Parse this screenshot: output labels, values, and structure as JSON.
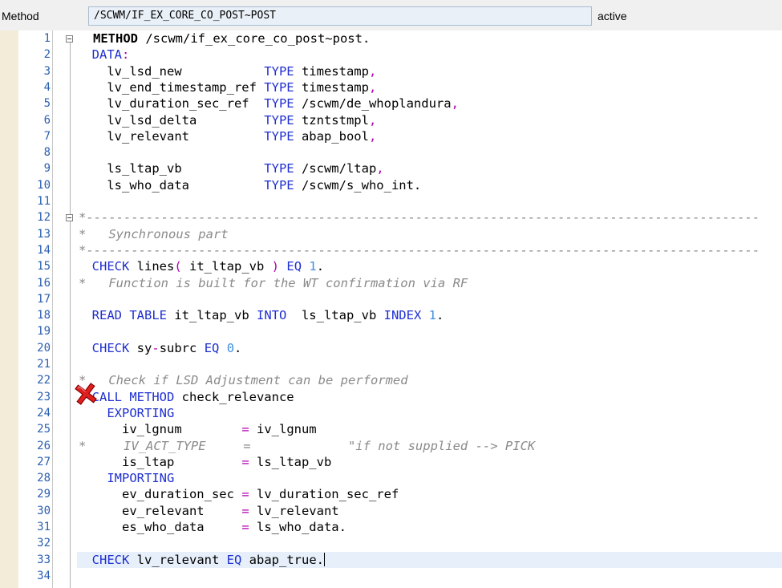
{
  "header": {
    "label": "Method",
    "method_name": "/SCWM/IF_EX_CORE_CO_POST~POST",
    "status": "active"
  },
  "editor": {
    "current_line": 33,
    "lines": [
      {
        "n": "1",
        "parts": [
          [
            "kwb",
            "METHOD"
          ],
          [
            "",
            " /scwm/if_ex_core_co_post~post."
          ]
        ]
      },
      {
        "n": "2",
        "parts": [
          [
            "",
            "  "
          ],
          [
            "kw",
            "DATA"
          ],
          [
            "op",
            ":"
          ]
        ]
      },
      {
        "n": "3",
        "parts": [
          [
            "",
            "    lv_lsd_new           "
          ],
          [
            "kw",
            "TYPE"
          ],
          [
            "",
            " timestamp"
          ],
          [
            "op",
            ","
          ]
        ]
      },
      {
        "n": "4",
        "parts": [
          [
            "",
            "    lv_end_timestamp_ref "
          ],
          [
            "kw",
            "TYPE"
          ],
          [
            "",
            " timestamp"
          ],
          [
            "op",
            ","
          ]
        ]
      },
      {
        "n": "5",
        "parts": [
          [
            "",
            "    lv_duration_sec_ref  "
          ],
          [
            "kw",
            "TYPE"
          ],
          [
            "",
            " /scwm/de_whoplandura"
          ],
          [
            "op",
            ","
          ]
        ]
      },
      {
        "n": "6",
        "parts": [
          [
            "",
            "    lv_lsd_delta         "
          ],
          [
            "kw",
            "TYPE"
          ],
          [
            "",
            " tzntstmpl"
          ],
          [
            "op",
            ","
          ]
        ]
      },
      {
        "n": "7",
        "parts": [
          [
            "",
            "    lv_relevant          "
          ],
          [
            "kw",
            "TYPE"
          ],
          [
            "",
            " abap_bool"
          ],
          [
            "op",
            ","
          ]
        ]
      },
      {
        "n": "8",
        "parts": []
      },
      {
        "n": "9",
        "parts": [
          [
            "",
            "    ls_ltap_vb           "
          ],
          [
            "kw",
            "TYPE"
          ],
          [
            "",
            " /scwm/ltap"
          ],
          [
            "op",
            ","
          ]
        ]
      },
      {
        "n": "10",
        "parts": [
          [
            "",
            "    ls_who_data          "
          ],
          [
            "kw",
            "TYPE"
          ],
          [
            "",
            " /scwm/s_who_int."
          ]
        ]
      },
      {
        "n": "11",
        "parts": []
      },
      {
        "n": "12",
        "parts": [
          [
            "cmt",
            "*------------------------------------------------------------------------------------------"
          ]
        ]
      },
      {
        "n": "13",
        "parts": [
          [
            "cmt",
            "*   Synchronous part"
          ]
        ]
      },
      {
        "n": "14",
        "parts": [
          [
            "cmt",
            "*------------------------------------------------------------------------------------------"
          ]
        ]
      },
      {
        "n": "15",
        "parts": [
          [
            "",
            "  "
          ],
          [
            "kw",
            "CHECK"
          ],
          [
            "",
            " lines"
          ],
          [
            "op",
            "("
          ],
          [
            "",
            " it_ltap_vb "
          ],
          [
            "op",
            ")"
          ],
          [
            "",
            " "
          ],
          [
            "kw",
            "EQ"
          ],
          [
            "",
            " "
          ],
          [
            "num",
            "1"
          ],
          [
            "",
            "."
          ]
        ]
      },
      {
        "n": "16",
        "parts": [
          [
            "cmt",
            "*   Function is built for the WT confirmation via RF"
          ]
        ]
      },
      {
        "n": "17",
        "parts": []
      },
      {
        "n": "18",
        "parts": [
          [
            "",
            "  "
          ],
          [
            "kw",
            "READ TABLE"
          ],
          [
            "",
            " it_ltap_vb "
          ],
          [
            "kw",
            "INTO"
          ],
          [
            "",
            "  ls_ltap_vb "
          ],
          [
            "kw",
            "INDEX"
          ],
          [
            "",
            " "
          ],
          [
            "num",
            "1"
          ],
          [
            "",
            "."
          ]
        ]
      },
      {
        "n": "19",
        "parts": []
      },
      {
        "n": "20",
        "parts": [
          [
            "",
            "  "
          ],
          [
            "kw",
            "CHECK"
          ],
          [
            "",
            " sy"
          ],
          [
            "op",
            "-"
          ],
          [
            "",
            "subrc "
          ],
          [
            "kw",
            "EQ"
          ],
          [
            "",
            " "
          ],
          [
            "num",
            "0"
          ],
          [
            "",
            "."
          ]
        ]
      },
      {
        "n": "21",
        "parts": []
      },
      {
        "n": "22",
        "parts": [
          [
            "cmt",
            "*   Check if LSD Adjustment can be performed"
          ]
        ]
      },
      {
        "n": "23",
        "parts": [
          [
            "",
            "  "
          ],
          [
            "kw",
            "CALL METHOD"
          ],
          [
            "",
            " check_relevance"
          ]
        ]
      },
      {
        "n": "24",
        "parts": [
          [
            "",
            "    "
          ],
          [
            "kw",
            "EXPORTING"
          ]
        ]
      },
      {
        "n": "25",
        "parts": [
          [
            "",
            "      iv_lgnum        "
          ],
          [
            "op",
            "="
          ],
          [
            "",
            " iv_lgnum"
          ]
        ]
      },
      {
        "n": "26",
        "parts": [
          [
            "cmt",
            "*     IV_ACT_TYPE     =             \"if not supplied --> PICK"
          ]
        ]
      },
      {
        "n": "27",
        "parts": [
          [
            "",
            "      is_ltap         "
          ],
          [
            "op",
            "="
          ],
          [
            "",
            " ls_ltap_vb"
          ]
        ]
      },
      {
        "n": "28",
        "parts": [
          [
            "",
            "    "
          ],
          [
            "kw",
            "IMPORTING"
          ]
        ]
      },
      {
        "n": "29",
        "parts": [
          [
            "",
            "      ev_duration_sec "
          ],
          [
            "op",
            "="
          ],
          [
            "",
            " lv_duration_sec_ref"
          ]
        ]
      },
      {
        "n": "30",
        "parts": [
          [
            "",
            "      ev_relevant     "
          ],
          [
            "op",
            "="
          ],
          [
            "",
            " lv_relevant"
          ]
        ]
      },
      {
        "n": "31",
        "parts": [
          [
            "",
            "      es_who_data     "
          ],
          [
            "op",
            "="
          ],
          [
            "",
            " ls_who_data."
          ]
        ]
      },
      {
        "n": "32",
        "parts": []
      },
      {
        "n": "33",
        "parts": [
          [
            "",
            "  "
          ],
          [
            "kw",
            "CHECK"
          ],
          [
            "",
            " lv_relevant "
          ],
          [
            "kw",
            "EQ"
          ],
          [
            "",
            " abap_true."
          ]
        ]
      },
      {
        "n": "34",
        "parts": []
      }
    ],
    "fold_markers": [
      1,
      12
    ],
    "error_marker_line": 23,
    "error_marker_icon": "red-x-icon"
  }
}
